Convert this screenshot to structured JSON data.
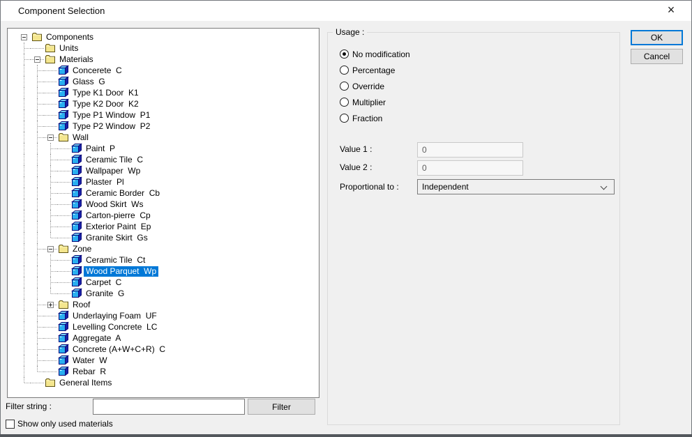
{
  "window": {
    "title": "Component Selection",
    "close_glyph": "×"
  },
  "tree": {
    "root": {
      "label": "Components",
      "icon": "folder",
      "expanded": true,
      "children": [
        {
          "label": "Units",
          "icon": "folder"
        },
        {
          "label": "Materials",
          "icon": "folder",
          "expanded": true,
          "children": [
            {
              "label": "Concerete  C",
              "icon": "material"
            },
            {
              "label": "Glass  G",
              "icon": "material"
            },
            {
              "label": "Type K1 Door  K1",
              "icon": "material"
            },
            {
              "label": "Type K2 Door  K2",
              "icon": "material"
            },
            {
              "label": "Type P1 Window  P1",
              "icon": "material"
            },
            {
              "label": "Type P2 Window  P2",
              "icon": "material"
            },
            {
              "label": "Wall",
              "icon": "folder",
              "expanded": true,
              "children": [
                {
                  "label": "Paint  P",
                  "icon": "material"
                },
                {
                  "label": "Ceramic Tile  C",
                  "icon": "material"
                },
                {
                  "label": "Wallpaper  Wp",
                  "icon": "material"
                },
                {
                  "label": "Plaster  Pl",
                  "icon": "material"
                },
                {
                  "label": "Ceramic Border  Cb",
                  "icon": "material"
                },
                {
                  "label": "Wood Skirt  Ws",
                  "icon": "material"
                },
                {
                  "label": "Carton-pierre  Cp",
                  "icon": "material"
                },
                {
                  "label": "Exterior Paint  Ep",
                  "icon": "material"
                },
                {
                  "label": "Granite Skirt  Gs",
                  "icon": "material"
                }
              ]
            },
            {
              "label": "Zone",
              "icon": "folder",
              "expanded": true,
              "children": [
                {
                  "label": "Ceramic Tile  Ct",
                  "icon": "material"
                },
                {
                  "label": "Wood Parquet  Wp",
                  "icon": "material",
                  "selected": true
                },
                {
                  "label": "Carpet  C",
                  "icon": "material"
                },
                {
                  "label": "Granite  G",
                  "icon": "material"
                }
              ]
            },
            {
              "label": "Roof",
              "icon": "folder",
              "expandable": true,
              "expanded": false
            },
            {
              "label": "Underlaying Foam  UF",
              "icon": "material"
            },
            {
              "label": "Levelling Concrete  LC",
              "icon": "material"
            },
            {
              "label": "Aggregate  A",
              "icon": "material"
            },
            {
              "label": "Concrete (A+W+C+R)  C",
              "icon": "material"
            },
            {
              "label": "Water  W",
              "icon": "material"
            },
            {
              "label": "Rebar  R",
              "icon": "material"
            }
          ]
        },
        {
          "label": "General Items",
          "icon": "folder"
        }
      ]
    },
    "selected_item": "Wood Parquet  Wp"
  },
  "filter": {
    "label": "Filter string :",
    "value": "",
    "button_label": "Filter"
  },
  "footer": {
    "checkbox_label": "Show only used materials",
    "checked": false
  },
  "usage": {
    "title": "Usage :",
    "options": [
      {
        "label": "No modification",
        "selected": true
      },
      {
        "label": "Percentage",
        "selected": false
      },
      {
        "label": "Override",
        "selected": false
      },
      {
        "label": "Multiplier",
        "selected": false
      },
      {
        "label": "Fraction",
        "selected": false
      }
    ],
    "value1": {
      "label": "Value 1 :",
      "value": "0",
      "disabled": true
    },
    "value2": {
      "label": "Value 2 :",
      "value": "0",
      "disabled": true
    },
    "proportional": {
      "label": "Proportional to :",
      "value": "Independent"
    }
  },
  "actions": {
    "ok": "OK",
    "cancel": "Cancel"
  },
  "colors": {
    "selection": "#0078d7",
    "dialog_bg": "#f0f0f0",
    "titlebar_bg": "#ffffff",
    "material_icon": "#29aef0",
    "folder_icon": "#f4e68e"
  }
}
